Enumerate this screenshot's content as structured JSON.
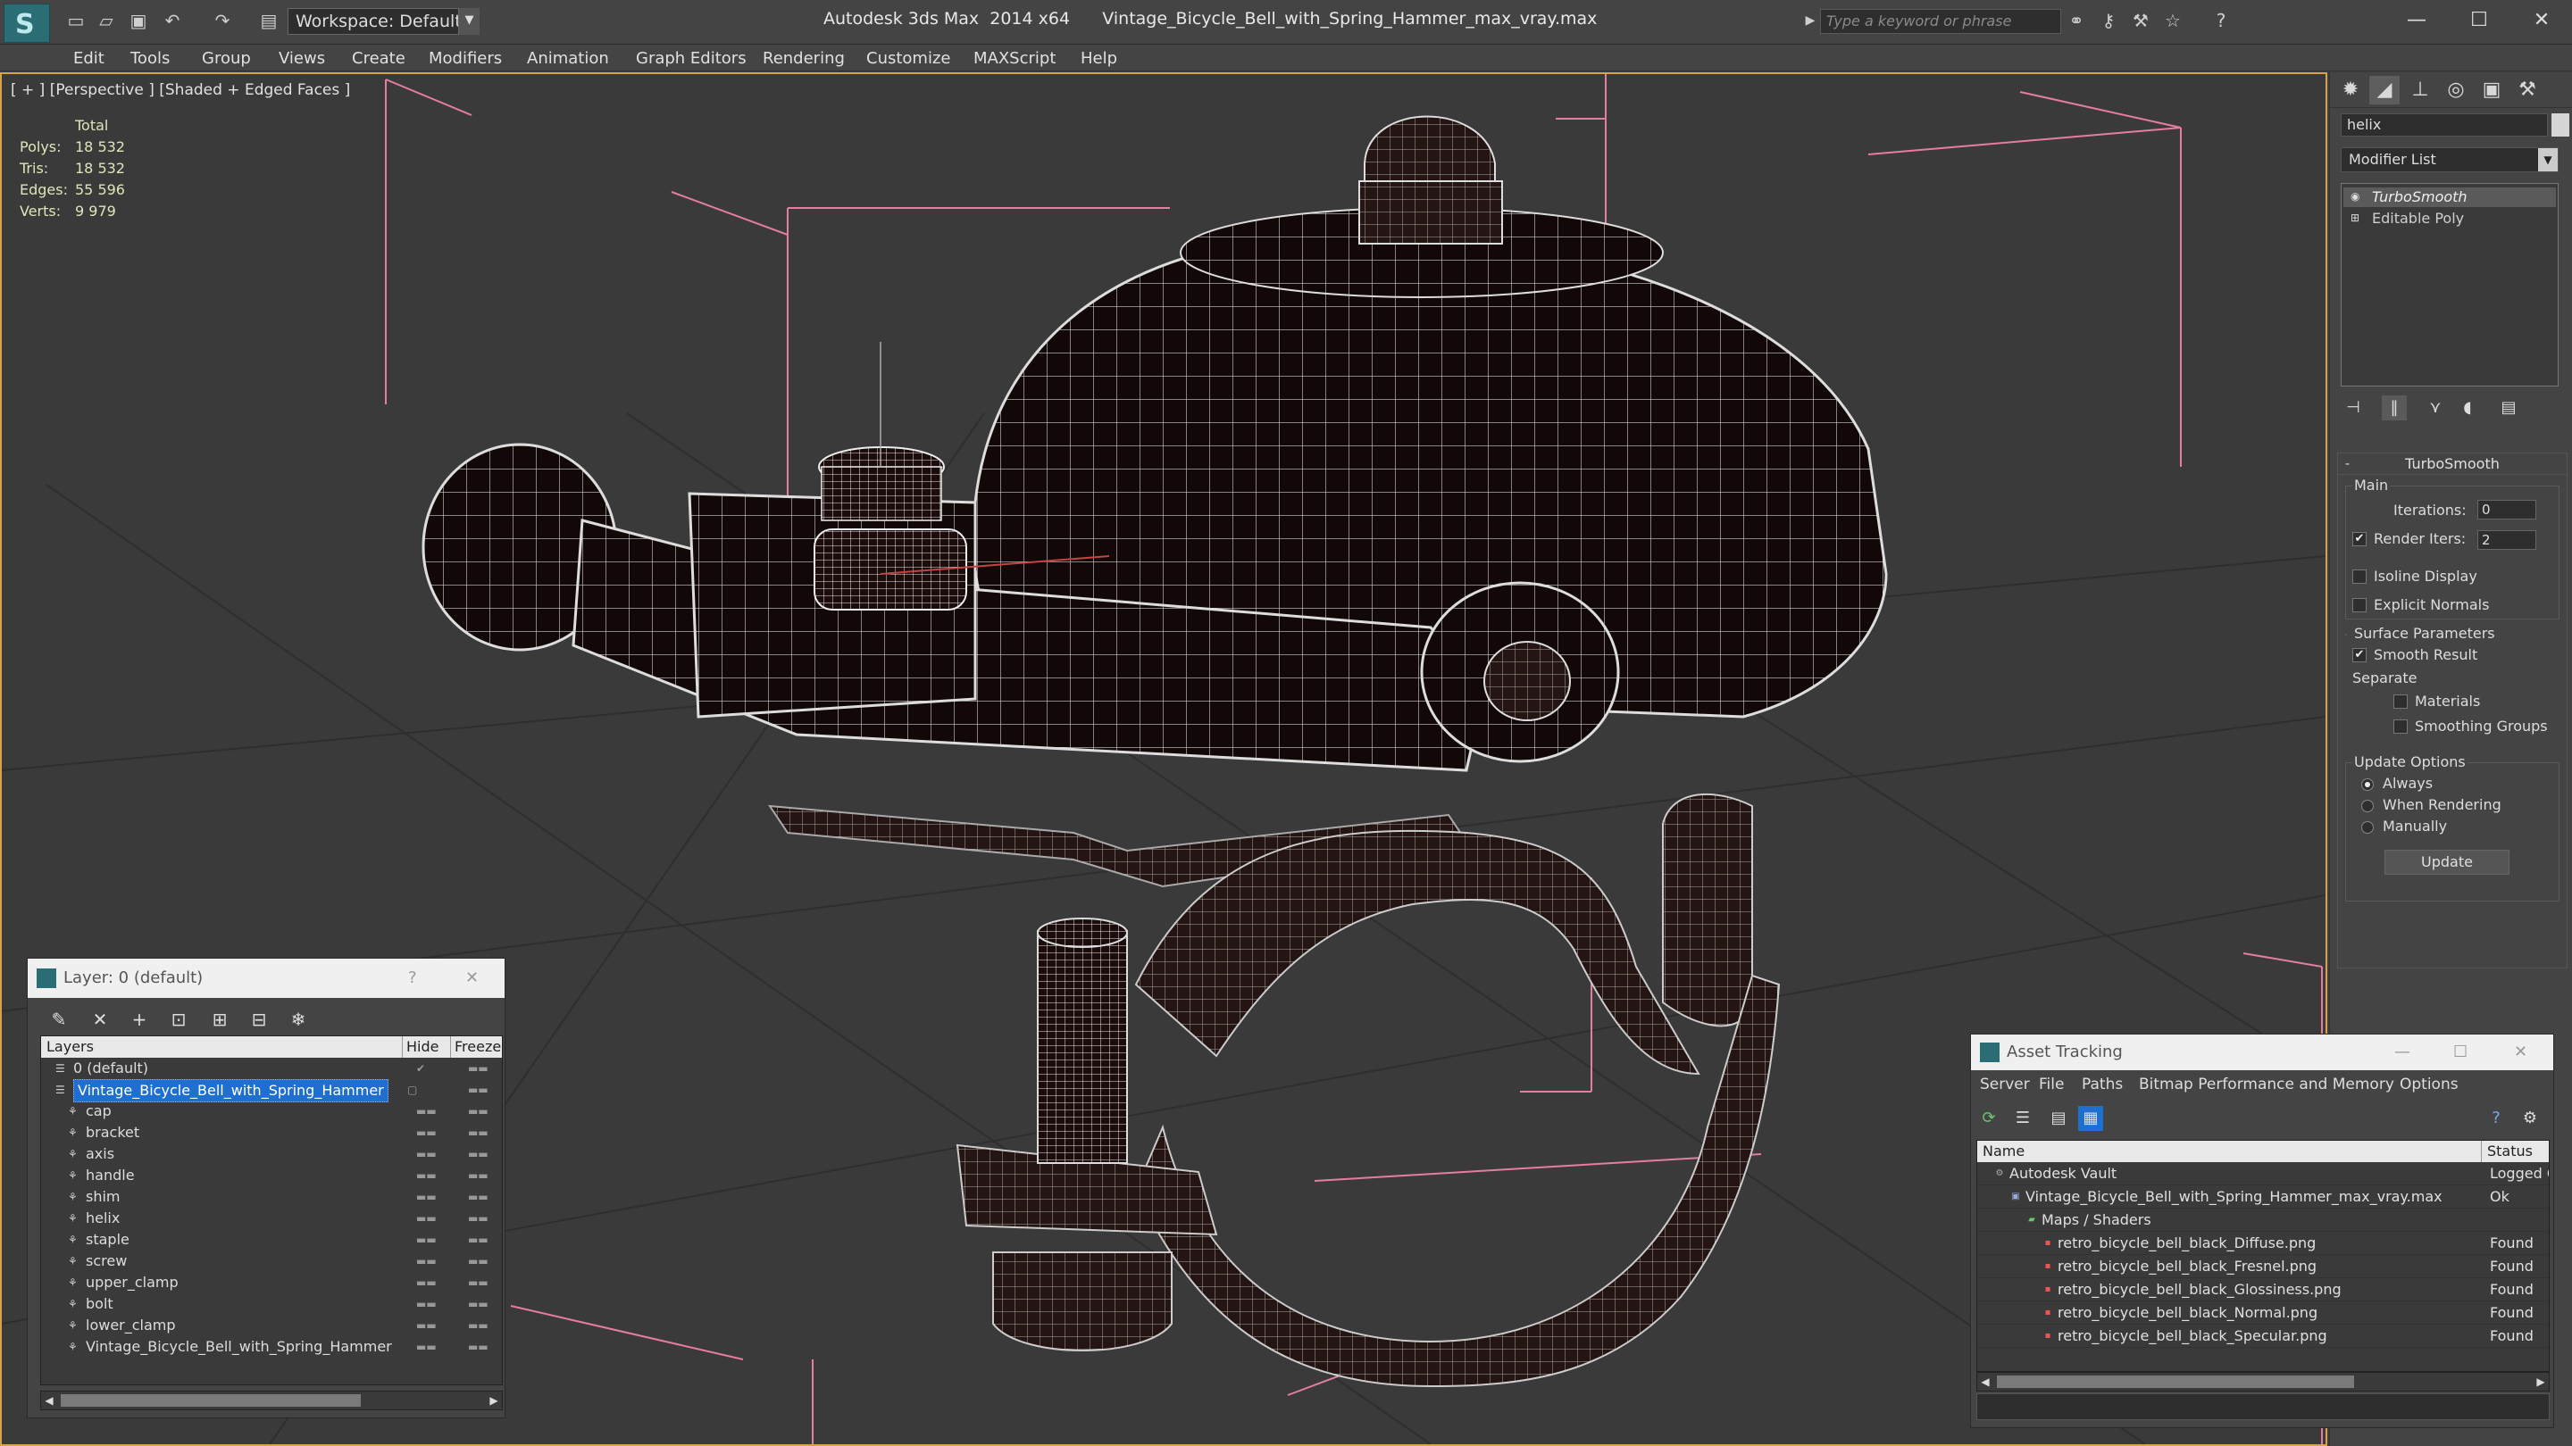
{
  "app": {
    "title": "Autodesk 3ds Max  2014 x64      Vintage_Bicycle_Bell_with_Spring_Hammer_max_vray.max",
    "workspace": "Workspace: Default",
    "search_placeholder": "Type a keyword or phrase"
  },
  "menu": [
    "Edit",
    "Tools",
    "Group",
    "Views",
    "Create",
    "Modifiers",
    "Animation",
    "Graph Editors",
    "Rendering",
    "Customize",
    "MAXScript",
    "Help"
  ],
  "viewport": {
    "label": "[ + ] [Perspective ] [Shaded + Edged Faces ]",
    "stats": {
      "header": "Total",
      "rows": [
        {
          "label": "Polys:",
          "value": "18 532"
        },
        {
          "label": "Tris:",
          "value": "18 532"
        },
        {
          "label": "Edges:",
          "value": "55 596"
        },
        {
          "label": "Verts:",
          "value": "9 979"
        }
      ]
    }
  },
  "command_panel": {
    "object_name": "helix",
    "modifier_list": "Modifier List",
    "stack": [
      "TurboSmooth",
      "Editable Poly"
    ],
    "rollout": {
      "title": "TurboSmooth",
      "main_label": "Main",
      "iterations_label": "Iterations:",
      "iterations_value": "0",
      "render_iters_label": "Render Iters:",
      "render_iters_value": "2",
      "isoline": "Isoline Display",
      "explicit_normals": "Explicit Normals",
      "surface_params": "Surface Parameters",
      "smooth_result": "Smooth Result",
      "separate": "Separate",
      "materials": "Materials",
      "smoothing_groups": "Smoothing Groups",
      "update_options": "Update Options",
      "always": "Always",
      "when_rendering": "When Rendering",
      "manually": "Manually",
      "update_button": "Update"
    }
  },
  "layer_window": {
    "title": "Layer: 0 (default)",
    "help": "?",
    "columns": {
      "layers": "Layers",
      "hide": "Hide",
      "freeze": "Freeze"
    },
    "rows": [
      {
        "name": "0 (default)",
        "level": 0
      },
      {
        "name": "Vintage_Bicycle_Bell_with_Spring_Hammer",
        "level": 0,
        "selected": true
      },
      {
        "name": "cap",
        "level": 1
      },
      {
        "name": "bracket",
        "level": 1
      },
      {
        "name": "axis",
        "level": 1
      },
      {
        "name": "handle",
        "level": 1
      },
      {
        "name": "shim",
        "level": 1
      },
      {
        "name": "helix",
        "level": 1
      },
      {
        "name": "staple",
        "level": 1
      },
      {
        "name": "screw",
        "level": 1
      },
      {
        "name": "upper_clamp",
        "level": 1
      },
      {
        "name": "bolt",
        "level": 1
      },
      {
        "name": "lower_clamp",
        "level": 1
      },
      {
        "name": "Vintage_Bicycle_Bell_with_Spring_Hammer",
        "level": 1
      }
    ]
  },
  "asset_window": {
    "title": "Asset Tracking",
    "menu": [
      "Server",
      "File",
      "Paths",
      "Bitmap Performance and Memory",
      "Options"
    ],
    "columns": {
      "name": "Name",
      "status": "Status"
    },
    "rows": [
      {
        "name": "Autodesk Vault",
        "status": "Logged O",
        "indent": 0
      },
      {
        "name": "Vintage_Bicycle_Bell_with_Spring_Hammer_max_vray.max",
        "status": "Ok",
        "indent": 1
      },
      {
        "name": "Maps / Shaders",
        "status": "",
        "indent": 2
      },
      {
        "name": "retro_bicycle_bell_black_Diffuse.png",
        "status": "Found",
        "indent": 3
      },
      {
        "name": "retro_bicycle_bell_black_Fresnel.png",
        "status": "Found",
        "indent": 3
      },
      {
        "name": "retro_bicycle_bell_black_Glossiness.png",
        "status": "Found",
        "indent": 3
      },
      {
        "name": "retro_bicycle_bell_black_Normal.png",
        "status": "Found",
        "indent": 3
      },
      {
        "name": "retro_bicycle_bell_black_Specular.png",
        "status": "Found",
        "indent": 3
      }
    ]
  },
  "colors": {
    "viewport_border": "#d8a24a",
    "selection": "#1e6fd0",
    "wire": "#d8d8d8",
    "mesh": "#1a0a0a"
  }
}
